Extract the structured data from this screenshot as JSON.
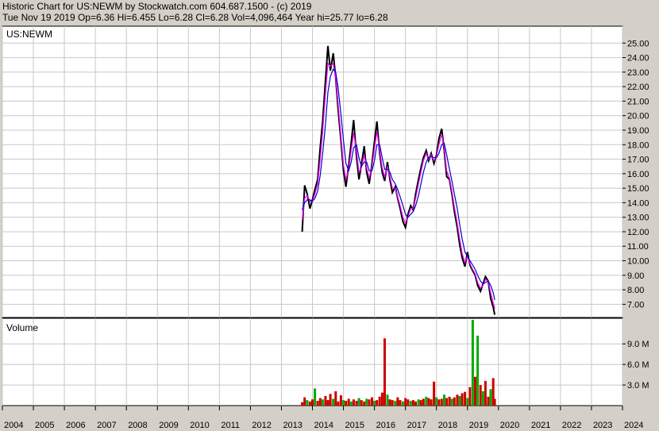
{
  "header": {
    "line1": "Historic Chart for US:NEWM by Stockwatch.com 604.687.1500 - (c) 2019",
    "line2": "Tue Nov 19 2019   Op=6.36   Hi=6.455   Lo=6.28   Cl=6.28   Vol=4,096,464   Year hi=25.77   lo=6.28"
  },
  "chart_data": [
    {
      "type": "line",
      "title": "US:NEWM",
      "ylim": [
        6.2,
        26.0
      ],
      "yticks": [
        "7.00",
        "8.00",
        "9.00",
        "10.00",
        "11.00",
        "12.00",
        "13.00",
        "14.00",
        "15.00",
        "16.00",
        "17.00",
        "18.00",
        "19.00",
        "20.00",
        "21.00",
        "22.00",
        "23.00",
        "24.00",
        "25.00"
      ],
      "grid": true,
      "x": [
        2013.67,
        2013.75,
        2013.83,
        2013.92,
        2014.0,
        2014.08,
        2014.17,
        2014.25,
        2014.33,
        2014.42,
        2014.5,
        2014.58,
        2014.67,
        2014.75,
        2014.83,
        2014.92,
        2015.0,
        2015.08,
        2015.17,
        2015.25,
        2015.33,
        2015.42,
        2015.5,
        2015.58,
        2015.67,
        2015.75,
        2015.83,
        2015.92,
        2016.0,
        2016.08,
        2016.17,
        2016.25,
        2016.33,
        2016.42,
        2016.5,
        2016.58,
        2016.67,
        2016.75,
        2016.83,
        2016.92,
        2017.0,
        2017.08,
        2017.17,
        2017.25,
        2017.33,
        2017.42,
        2017.5,
        2017.58,
        2017.67,
        2017.75,
        2017.83,
        2017.92,
        2018.0,
        2018.08,
        2018.17,
        2018.25,
        2018.33,
        2018.42,
        2018.5,
        2018.58,
        2018.67,
        2018.75,
        2018.83,
        2018.92,
        2019.0,
        2019.08,
        2019.17,
        2019.25,
        2019.33,
        2019.42,
        2019.5,
        2019.58,
        2019.67,
        2019.75,
        2019.83,
        2019.88
      ],
      "series": [
        {
          "color": "#000000",
          "values": [
            12.0,
            15.2,
            14.6,
            13.6,
            14.2,
            14.9,
            15.6,
            17.8,
            19.6,
            22.4,
            24.8,
            23.1,
            24.3,
            22.6,
            20.4,
            18.3,
            16.2,
            15.1,
            16.6,
            18.1,
            19.7,
            17.2,
            15.6,
            16.6,
            17.9,
            16.1,
            15.3,
            16.7,
            18.2,
            19.6,
            17.4,
            16.1,
            15.5,
            16.8,
            15.6,
            14.7,
            15.1,
            14.3,
            13.6,
            12.7,
            12.3,
            13.2,
            13.8,
            13.5,
            14.6,
            15.6,
            16.4,
            17.1,
            17.6,
            16.9,
            17.4,
            16.7,
            17.3,
            18.4,
            19.1,
            17.6,
            15.8,
            15.6,
            14.6,
            13.4,
            12.3,
            11.1,
            10.2,
            9.6,
            10.6,
            9.7,
            9.3,
            9.0,
            8.3,
            7.9,
            8.4,
            8.9,
            8.6,
            7.4,
            6.8,
            6.28
          ]
        },
        {
          "color": "#ff00ff",
          "values": [
            12.8,
            14.3,
            14.5,
            14.1,
            14.1,
            14.6,
            15.3,
            17.0,
            18.9,
            21.5,
            23.6,
            23.4,
            23.6,
            22.6,
            20.8,
            18.6,
            16.6,
            15.6,
            16.3,
            17.6,
            18.8,
            17.6,
            16.1,
            16.4,
            17.3,
            16.4,
            15.7,
            16.5,
            17.7,
            18.9,
            17.6,
            16.4,
            15.8,
            16.5,
            15.8,
            15.0,
            15.0,
            14.4,
            13.8,
            13.0,
            12.6,
            13.0,
            13.6,
            13.6,
            14.3,
            15.3,
            16.1,
            16.9,
            17.4,
            17.0,
            17.3,
            16.9,
            17.2,
            18.0,
            18.7,
            17.8,
            16.2,
            15.7,
            14.8,
            13.7,
            12.6,
            11.5,
            10.5,
            9.9,
            10.3,
            9.8,
            9.4,
            9.1,
            8.5,
            8.1,
            8.3,
            8.7,
            8.6,
            7.8,
            7.1,
            6.7
          ]
        },
        {
          "color": "#0000cc",
          "values": [
            13.5,
            14.0,
            14.2,
            14.2,
            14.1,
            14.3,
            14.8,
            15.9,
            17.4,
            19.4,
            21.6,
            22.7,
            23.2,
            23.0,
            21.9,
            20.1,
            18.3,
            16.7,
            16.2,
            16.8,
            17.8,
            18.0,
            17.1,
            16.5,
            16.8,
            16.8,
            16.2,
            16.2,
            16.9,
            18.0,
            18.0,
            17.1,
            16.3,
            16.3,
            16.1,
            15.6,
            15.3,
            14.9,
            14.4,
            13.8,
            13.2,
            13.0,
            13.2,
            13.4,
            13.8,
            14.5,
            15.3,
            16.1,
            16.8,
            17.1,
            17.2,
            17.1,
            17.1,
            17.4,
            18.0,
            18.1,
            17.3,
            16.3,
            15.5,
            14.6,
            13.6,
            12.5,
            11.5,
            10.6,
            10.3,
            10.0,
            9.7,
            9.4,
            9.0,
            8.6,
            8.4,
            8.5,
            8.6,
            8.3,
            7.8,
            7.3
          ]
        }
      ]
    },
    {
      "type": "bar",
      "title": "Volume",
      "ylim": [
        0,
        12.5
      ],
      "yticks": [
        "3.0 M",
        "6.0 M",
        "9.0 M"
      ],
      "x": [
        2013.67,
        2013.75,
        2013.83,
        2013.92,
        2014.0,
        2014.08,
        2014.17,
        2014.25,
        2014.33,
        2014.42,
        2014.5,
        2014.58,
        2014.67,
        2014.75,
        2014.83,
        2014.92,
        2015.0,
        2015.08,
        2015.17,
        2015.25,
        2015.33,
        2015.42,
        2015.5,
        2015.58,
        2015.67,
        2015.75,
        2015.83,
        2015.92,
        2016.0,
        2016.08,
        2016.17,
        2016.25,
        2016.33,
        2016.42,
        2016.5,
        2016.58,
        2016.67,
        2016.75,
        2016.83,
        2016.92,
        2017.0,
        2017.08,
        2017.17,
        2017.25,
        2017.33,
        2017.42,
        2017.5,
        2017.58,
        2017.67,
        2017.75,
        2017.83,
        2017.92,
        2018.0,
        2018.08,
        2018.17,
        2018.25,
        2018.33,
        2018.42,
        2018.5,
        2018.58,
        2018.67,
        2018.75,
        2018.83,
        2018.92,
        2019.0,
        2019.08,
        2019.17,
        2019.25,
        2019.33,
        2019.42,
        2019.5,
        2019.58,
        2019.67,
        2019.75,
        2019.83,
        2019.88
      ],
      "values": [
        0.5,
        1.2,
        0.8,
        0.6,
        0.9,
        2.5,
        0.7,
        1.1,
        0.9,
        1.4,
        0.8,
        1.7,
        1.0,
        2.1,
        0.6,
        1.5,
        0.8,
        0.7,
        1.0,
        0.6,
        0.9,
        0.7,
        1.1,
        0.8,
        0.6,
        1.0,
        0.9,
        1.2,
        0.7,
        0.8,
        1.3,
        1.9,
        9.8,
        1.6,
        0.9,
        0.8,
        0.7,
        1.2,
        0.8,
        0.6,
        1.1,
        0.9,
        0.7,
        0.8,
        0.6,
        0.9,
        0.8,
        1.0,
        1.3,
        1.1,
        0.9,
        3.5,
        1.2,
        0.9,
        1.0,
        1.6,
        1.1,
        1.3,
        1.0,
        1.2,
        1.6,
        1.4,
        1.8,
        2.0,
        1.1,
        2.7,
        12.5,
        4.2,
        10.2,
        3.0,
        2.1,
        3.6,
        1.3,
        2.4,
        4.0,
        1.0
      ],
      "colors": [
        "#cc0000",
        "#cc0000",
        "#00aa00",
        "#cc0000",
        "#cc0000",
        "#00aa00",
        "#cc0000",
        "#cc0000",
        "#00aa00",
        "#cc0000",
        "#cc0000",
        "#cc0000",
        "#00aa00",
        "#cc0000",
        "#cc0000",
        "#cc0000",
        "#00aa00",
        "#cc0000",
        "#cc0000",
        "#00aa00",
        "#cc0000",
        "#cc0000",
        "#00aa00",
        "#cc0000",
        "#cc0000",
        "#00aa00",
        "#cc0000",
        "#cc0000",
        "#00aa00",
        "#cc0000",
        "#cc0000",
        "#cc0000",
        "#cc0000",
        "#00aa00",
        "#cc0000",
        "#cc0000",
        "#00aa00",
        "#cc0000",
        "#cc0000",
        "#00aa00",
        "#cc0000",
        "#cc0000",
        "#00aa00",
        "#cc0000",
        "#cc0000",
        "#00aa00",
        "#cc0000",
        "#cc0000",
        "#00aa00",
        "#cc0000",
        "#cc0000",
        "#cc0000",
        "#00aa00",
        "#cc0000",
        "#cc0000",
        "#00aa00",
        "#cc0000",
        "#cc0000",
        "#00aa00",
        "#cc0000",
        "#cc0000",
        "#00aa00",
        "#cc0000",
        "#cc0000",
        "#00aa00",
        "#cc0000",
        "#00aa00",
        "#cc0000",
        "#00aa00",
        "#cc0000",
        "#00aa00",
        "#cc0000",
        "#cc0000",
        "#00aa00",
        "#cc0000",
        "#cc0000"
      ]
    }
  ],
  "x_axis": {
    "labels": [
      "2004",
      "2005",
      "2006",
      "2007",
      "2008",
      "2009",
      "2010",
      "2011",
      "2012",
      "2013",
      "2014",
      "2015",
      "2016",
      "2017",
      "2018",
      "2019",
      "2020",
      "2021",
      "2022",
      "2023",
      "2024"
    ],
    "xlim": [
      2004,
      2024
    ]
  },
  "colors": {
    "background": "#d4d0c8",
    "panel": "#ffffff",
    "grid": "#c8c8c8"
  }
}
